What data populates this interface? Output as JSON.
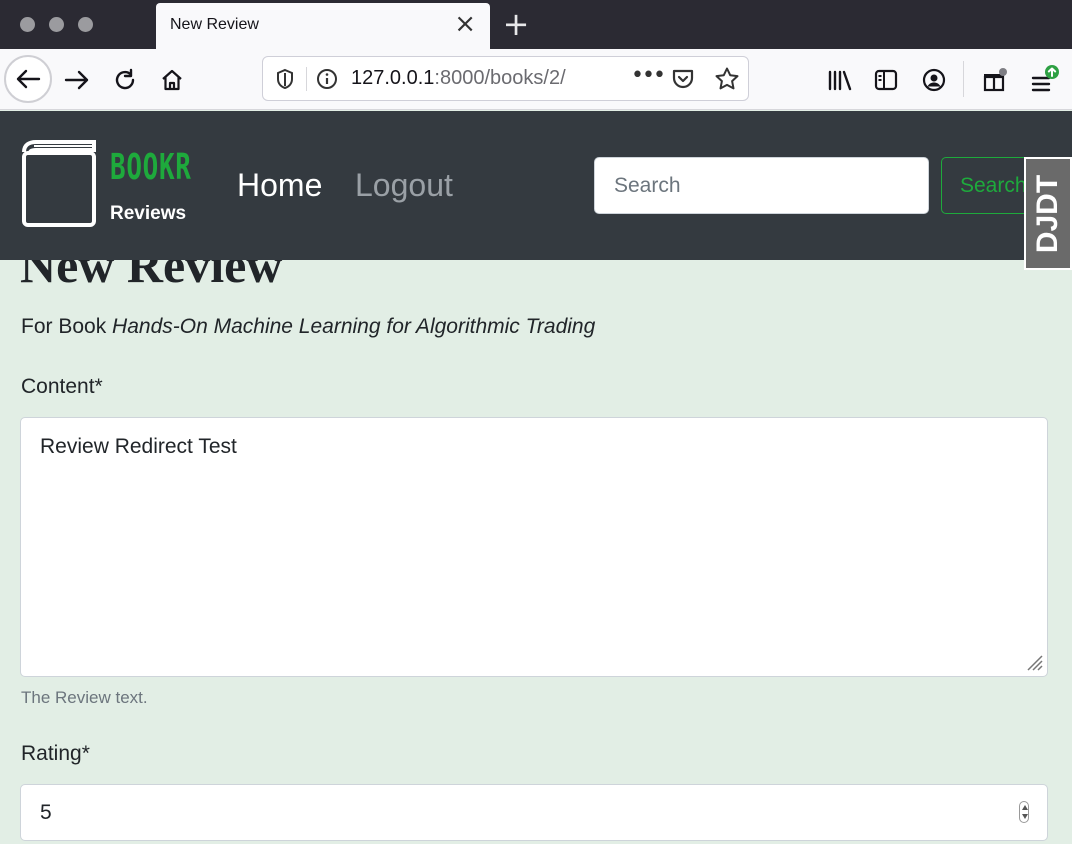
{
  "browser": {
    "tab_title": "New Review",
    "url_host": "127.0.0.1",
    "url_path": ":8000/books/2/"
  },
  "navbar": {
    "brand_name": "BOOKR",
    "brand_sub": "Reviews",
    "links": [
      {
        "label": "Home"
      },
      {
        "label": "Logout"
      }
    ],
    "search_placeholder": "Search",
    "search_button": "Search",
    "debug_toolbar_label": "DJDT"
  },
  "page": {
    "title": "New Review",
    "subtitle_prefix": "For Book ",
    "book_title": "Hands-On Machine Learning for Algorithmic Trading",
    "content_label": "Content*",
    "content_value": "Review Redirect Test",
    "content_help": "The Review text.",
    "rating_label": "Rating*",
    "rating_value": "5"
  },
  "colors": {
    "navbar_bg": "#343a40",
    "brand_green": "#1eaa3c",
    "page_bg": "#e2eee5"
  }
}
